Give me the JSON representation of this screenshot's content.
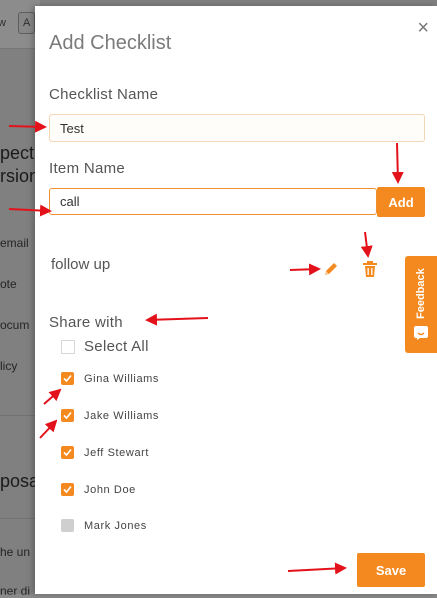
{
  "background": {
    "tab_a": "w",
    "tab_b": "A",
    "lines": [
      "pect",
      "rsion",
      "email",
      "ote",
      "ocum",
      "licy",
      "posa",
      "he un",
      "ner di"
    ]
  },
  "modal": {
    "title": "Add Checklist",
    "close_icon": "×",
    "checklist_name_label": "Checklist Name",
    "checklist_name_value": "Test",
    "item_name_label": "Item Name",
    "item_name_value": "call",
    "add_label": "Add",
    "items": [
      {
        "label": "follow up"
      }
    ],
    "share_with_label": "Share with",
    "select_all_label": "Select All",
    "members": [
      {
        "name": "Gina Williams",
        "checked": true
      },
      {
        "name": "Jake Williams",
        "checked": true
      },
      {
        "name": "Jeff Stewart",
        "checked": true
      },
      {
        "name": "John Doe",
        "checked": true
      },
      {
        "name": "Mark Jones",
        "checked": false
      }
    ],
    "save_label": "Save"
  },
  "feedback": {
    "label": "Feedback",
    "icon": "chat-smile-icon"
  },
  "colors": {
    "accent": "#f48a1f",
    "annotation_arrow": "#e3121a",
    "title_gray": "#7b7b7b"
  }
}
